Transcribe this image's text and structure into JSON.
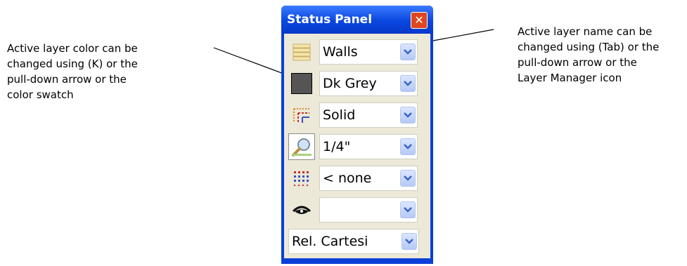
{
  "panel": {
    "title": "Status Panel",
    "close_label": "✕",
    "rows": [
      {
        "icon": "layer-stack-icon",
        "value": "Walls"
      },
      {
        "icon": "color-swatch-icon",
        "value": "Dk Grey"
      },
      {
        "icon": "line-style-icon",
        "value": "Solid"
      },
      {
        "icon": "zoom-magnifier-icon",
        "value": "1/4\""
      },
      {
        "icon": "grid-snap-icon",
        "value": "< none"
      },
      {
        "icon": "visibility-eye-icon",
        "value": ""
      },
      {
        "icon": null,
        "value": "Rel. Cartesi"
      }
    ]
  },
  "callouts": {
    "left": "Active layer color can be\nchanged using (K) or the\npull-down arrow or the\ncolor swatch",
    "right": "Active layer name can be\nchanged using (Tab) or the\npull-down arrow or the\nLayer Manager icon"
  },
  "colors": {
    "titlebar": "#0a47e0",
    "panel_bg": "#ece9d8",
    "close_button": "#e0461f",
    "swatch": "#555555",
    "dropdown_arrow": "#3a62c8"
  }
}
